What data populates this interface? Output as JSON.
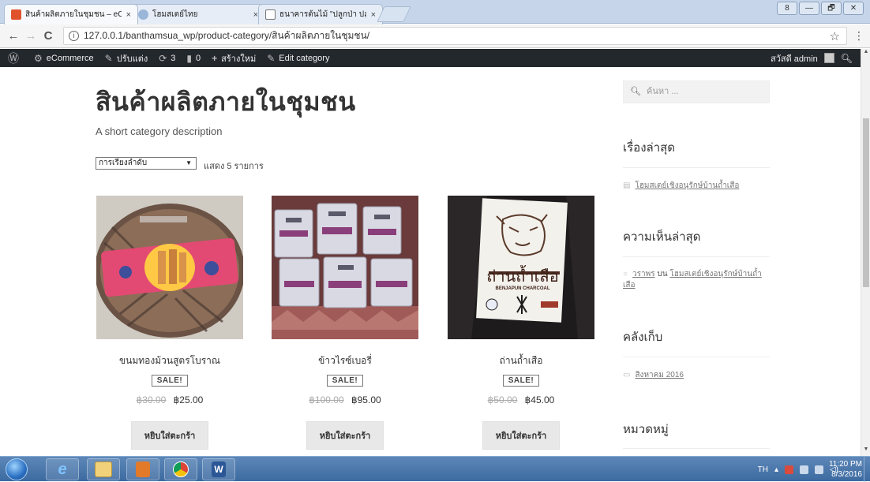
{
  "browser": {
    "tabs": [
      {
        "title": "สินค้าผลิตภายในชุมชน – eC",
        "close": "×",
        "active": true,
        "icon_color": "#e0522c"
      },
      {
        "title": "โฮมสเตย์ไทย",
        "close": "×",
        "active": false,
        "icon_color": "#9ab6d8"
      },
      {
        "title": "ธนาคารต้นไม้ \"ปลูกป่า ปลูก",
        "close": "×",
        "active": false,
        "icon_color": "#ffffff"
      }
    ],
    "url": "127.0.0.1/banthamsua_wp/product-category/สินค้าผลิตภายในชุมชน/",
    "window_controls": [
      "8",
      "—",
      "🗗",
      "✕"
    ]
  },
  "adminbar": {
    "items": [
      {
        "icon": "wordpress-icon",
        "glyph": "Ⓦ",
        "label": ""
      },
      {
        "icon": "dashboard-icon",
        "glyph": "⚙",
        "label": "eCommerce"
      },
      {
        "icon": "customize-icon",
        "glyph": "✎",
        "label": "ปรับแต่ง"
      },
      {
        "icon": "updates-icon",
        "glyph": "⟳",
        "label": "3"
      },
      {
        "icon": "comments-icon",
        "glyph": "▮",
        "label": "0"
      },
      {
        "icon": "plus-icon",
        "glyph": "+",
        "label": "สร้างใหม่"
      },
      {
        "icon": "pencil-icon",
        "glyph": "✎",
        "label": "Edit category"
      }
    ],
    "greeting": "สวัสดี admin"
  },
  "page": {
    "title": "สินค้าผลิตภายในชุมชน",
    "description": "A short category description",
    "sort_label": "การเรียงลำดับ",
    "result_count": "แสดง 5 รายการ"
  },
  "products": [
    {
      "name": "ขนมทองม้วนสูตรโบราณ",
      "sale": "SALE!",
      "old_price": "฿30.00",
      "price": "฿25.00",
      "button": "หยิบใส่ตะกร้า"
    },
    {
      "name": "ข้าวไรซ์เบอรี่",
      "sale": "SALE!",
      "old_price": "฿100.00",
      "price": "฿95.00",
      "button": "หยิบใส่ตะกร้า"
    },
    {
      "name": "ถ่านถ้ำเสือ",
      "sale": "SALE!",
      "old_price": "฿50.00",
      "price": "฿45.00",
      "button": "หยิบใส่ตะกร้า",
      "label_text": "ถ่านถ้ำเสือ",
      "label_sub": "BENJAPUN CHARCOAL"
    }
  ],
  "sidebar": {
    "search_placeholder": "ค้นหา ...",
    "recent_posts_title": "เรื่องล่าสุด",
    "recent_post": "โฮมสเตย์เชิงอนุรักษ์บ้านถ้ำเสือ",
    "recent_comments_title": "ความเห็นล่าสุด",
    "comment_author": "วราพร",
    "comment_on": "บน",
    "comment_post": "โฮมสเตย์เชิงอนุรักษ์บ้านถ้ำเสือ",
    "archives_title": "คลังเก็บ",
    "archive_item": "สิงหาคม 2016",
    "categories_title": "หมวดหมู่"
  },
  "taskbar": {
    "lang": "TH",
    "time": "11:20 PM",
    "date": "8/3/2016"
  }
}
